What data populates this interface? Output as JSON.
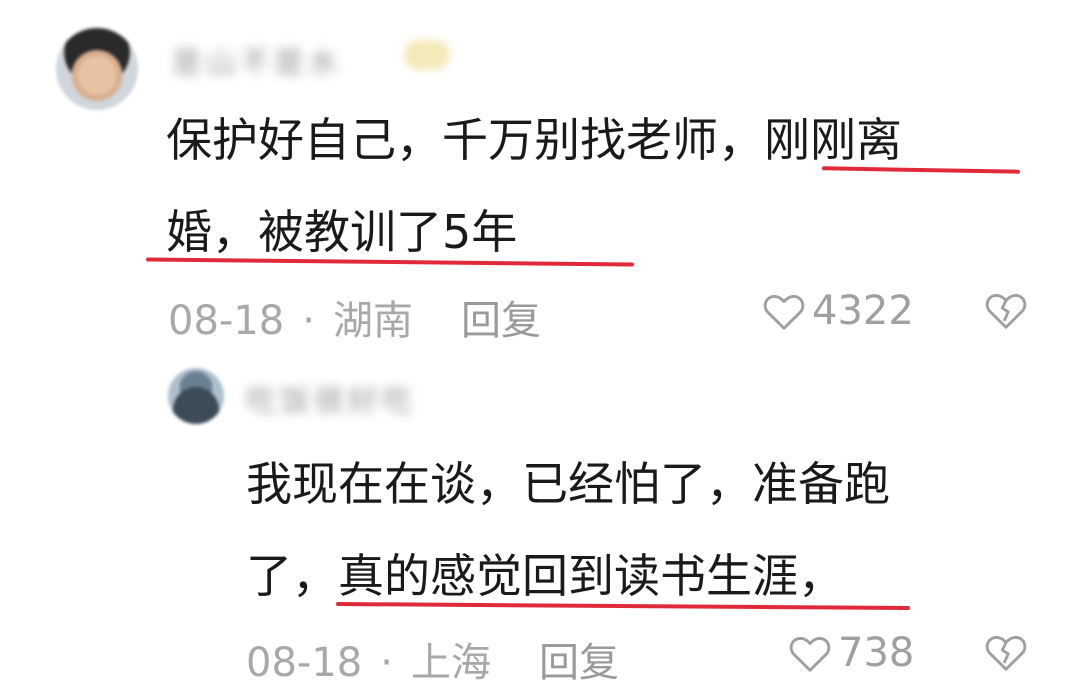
{
  "comments": [
    {
      "author_blurred": "是山不是水",
      "text_line1": "保护好自己，千万别找老师，刚刚离",
      "text_line2": "婚，被教训了5年",
      "date": "08-18",
      "separator": "·",
      "location": "湖南",
      "reply_label": "回复",
      "likes": "4322",
      "like_icon": "heart-outline-icon",
      "dislike_icon": "broken-heart-icon"
    },
    {
      "author_blurred": "吃饭很好吃",
      "text_line1": "我现在在谈，已经怕了，准备跑",
      "text_line2": "了，真的感觉回到读书生涯，",
      "date": "08-18",
      "separator": "·",
      "location": "上海",
      "reply_label": "回复",
      "likes": "738",
      "like_icon": "heart-outline-icon",
      "dislike_icon": "broken-heart-icon"
    }
  ],
  "colors": {
    "underline": "#e02a3a",
    "meta_text": "#a8a8a8",
    "body_text": "#1a1a1a"
  }
}
